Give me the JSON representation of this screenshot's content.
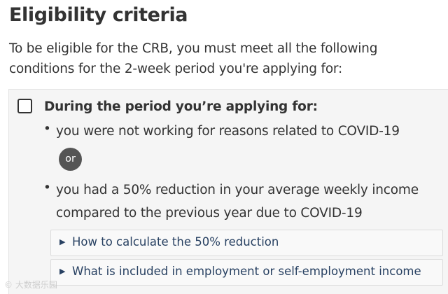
{
  "section": {
    "heading": "Eligibility criteria",
    "intro": "To be eligible for the CRB, you must meet all the following conditions for the 2-week period you're applying for:"
  },
  "criterion": {
    "checkbox_checked": false,
    "title": "During the period you’re applying for:",
    "bullet_char": "•",
    "conditions": [
      "you were not working for reasons related to COVID-19",
      "you had a 50% reduction in your average weekly income compared to the previous year due to COVID-19"
    ],
    "separator": "or",
    "expanders": [
      {
        "label": "How to calculate the 50% reduction",
        "expanded": false
      },
      {
        "label": "What is included in employment or self-employment income",
        "expanded": false
      }
    ],
    "expander_marker": "▶"
  },
  "watermark": "© 大数据乐园",
  "colors": {
    "text": "#333333",
    "link": "#284162",
    "panel_bg": "#f5f5f5",
    "badge_bg": "#555555"
  }
}
